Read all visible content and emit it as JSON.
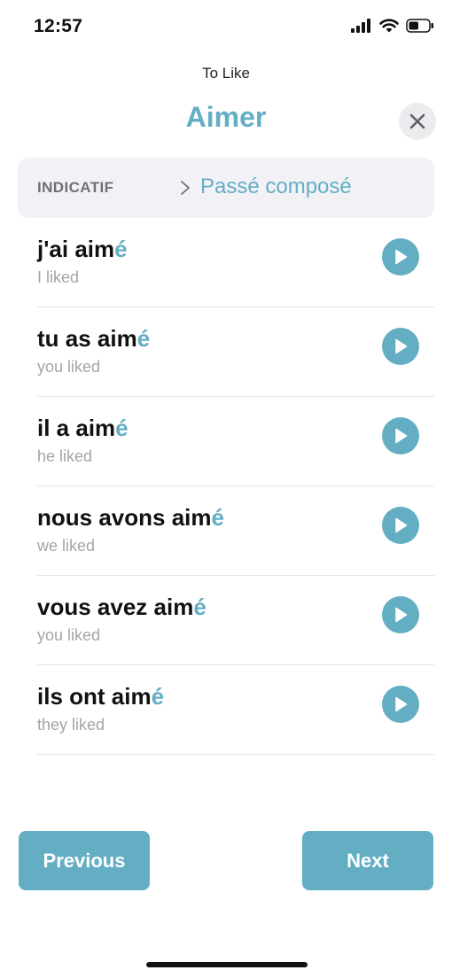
{
  "status_bar": {
    "time": "12:57",
    "icons": [
      "cellular-signal-icon",
      "wifi-icon",
      "battery-icon"
    ],
    "battery_level": 0.5
  },
  "header": {
    "subtitle": "To Like",
    "title": "Aimer",
    "close_icon": "close-icon"
  },
  "tense_selector": {
    "mood": "INDICATIF",
    "separator_icon": "chevron-right-icon",
    "tense": "Passé composé"
  },
  "conjugations": [
    {
      "stem": "j'ai aim",
      "ending": "é",
      "translation": "I liked"
    },
    {
      "stem": "tu as aim",
      "ending": "é",
      "translation": "you liked"
    },
    {
      "stem": "il a aim",
      "ending": "é",
      "translation": "he liked"
    },
    {
      "stem": "nous avons aim",
      "ending": "é",
      "translation": "we liked"
    },
    {
      "stem": "vous avez aim",
      "ending": "é",
      "translation": "you liked"
    },
    {
      "stem": "ils ont aim",
      "ending": "é",
      "translation": "they liked"
    }
  ],
  "footer": {
    "previous_label": "Previous",
    "next_label": "Next"
  },
  "colors": {
    "accent": "#64aec4",
    "muted_text": "#a4a4aa",
    "tense_bar_bg": "#f2f2f6",
    "close_bg": "#ececee"
  }
}
